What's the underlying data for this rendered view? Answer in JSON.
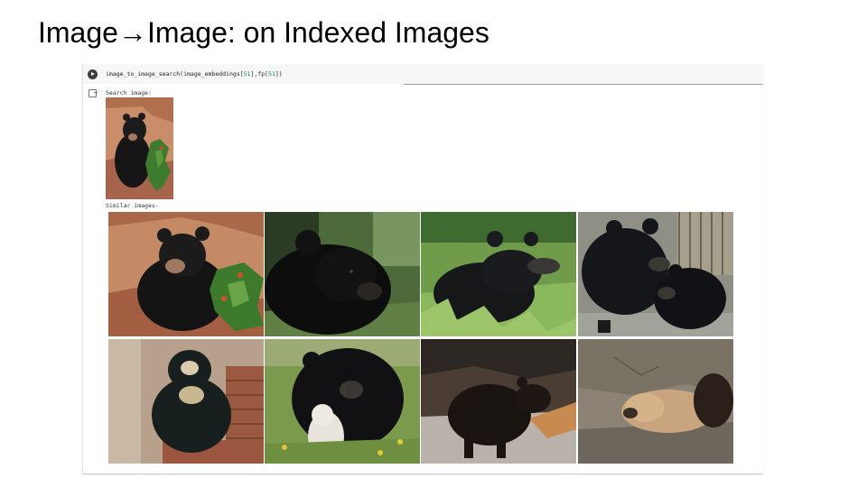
{
  "slide": {
    "title": "Image→Image: on Indexed Images"
  },
  "notebook": {
    "cell": {
      "code_parts": [
        "image_to_image_search(image_embeddings[",
        "51",
        "],fp[",
        "51",
        "])"
      ]
    },
    "output": {
      "search_label": "Search image:",
      "similar_label": "Similar images-",
      "query_image": {
        "icon": "black-bear-cub-photo"
      },
      "results": [
        {
          "icon": "black-bear-cub-rocks-photo"
        },
        {
          "icon": "black-bear-grass-photo"
        },
        {
          "icon": "black-bear-meadow-photo"
        },
        {
          "icon": "two-black-bears-enclosure-photo"
        },
        {
          "icon": "spectacled-bear-brick-wall-photo"
        },
        {
          "icon": "black-bear-with-white-cub-photo"
        },
        {
          "icon": "black-bear-walking-rocks-photo"
        },
        {
          "icon": "brown-bear-sleeping-rock-photo"
        }
      ]
    }
  }
}
